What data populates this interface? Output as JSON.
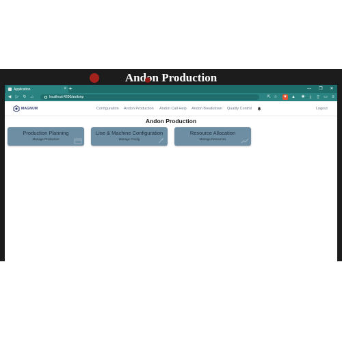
{
  "video": {
    "title": "Andon Production"
  },
  "browser": {
    "tab_title": "Application",
    "tab_close": "×",
    "new_tab": "+",
    "url": "localhost:4200/andonp"
  },
  "app": {
    "logo_text": "MAGNUM",
    "nav": [
      {
        "label": "Configuration"
      },
      {
        "label": "Andon Production"
      },
      {
        "label": "Andon Call Help"
      },
      {
        "label": "Andon Breakdown"
      },
      {
        "label": "Quality Control"
      }
    ],
    "logout": "Logout"
  },
  "main": {
    "title": "Andon Production",
    "cards": [
      {
        "title": "Production Planning",
        "subtitle": "Manage Production"
      },
      {
        "title": "Line & Machine Configuration",
        "subtitle": "Manage Config"
      },
      {
        "title": "Resource Allocation",
        "subtitle": "Manage Resources"
      }
    ]
  },
  "colors": {
    "browser_chrome": "#1e6d6b",
    "card_bg": "#6e8ea3",
    "video_bg": "#1c1c1c"
  }
}
